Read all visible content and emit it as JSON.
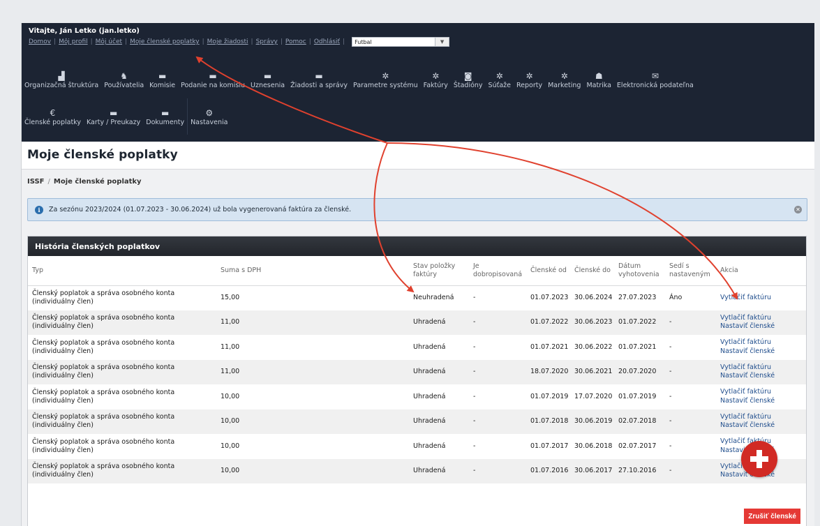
{
  "header": {
    "welcome": "Vitajte, Ján Letko (jan.letko)",
    "links": [
      "Domov",
      "Môj profil",
      "Môj účet",
      "Moje členské poplatky",
      "Moje žiadosti",
      "Správy",
      "Pomoc",
      "Odhlásiť"
    ],
    "sport_select_value": "Futbal"
  },
  "menu": {
    "row1": [
      {
        "label": "Organizačná štruktúra",
        "icon": "org-structure-icon",
        "glyph": "▟"
      },
      {
        "label": "Používatelia",
        "icon": "users-icon",
        "glyph": "♞"
      },
      {
        "label": "Komisie",
        "icon": "folder-icon",
        "glyph": "▬"
      },
      {
        "label": "Podanie na komisiu",
        "icon": "folder-icon",
        "glyph": "▬"
      },
      {
        "label": "Uznesenia",
        "icon": "folder-icon",
        "glyph": "▬"
      },
      {
        "label": "Žiadosti a správy",
        "icon": "folder-icon",
        "glyph": "▬"
      },
      {
        "label": "Parametre systému",
        "icon": "gears-icon",
        "glyph": "✲"
      },
      {
        "label": "Faktúry",
        "icon": "gears-icon",
        "glyph": "✲"
      },
      {
        "label": "Štadióny",
        "icon": "stadium-icon",
        "glyph": "◙"
      },
      {
        "label": "Súťaže",
        "icon": "gears-icon",
        "glyph": "✲"
      },
      {
        "label": "Reporty",
        "icon": "gears-icon",
        "glyph": "✲"
      },
      {
        "label": "Marketing",
        "icon": "gears-icon",
        "glyph": "✲"
      },
      {
        "label": "Matrika",
        "icon": "registry-icon",
        "glyph": "☗"
      },
      {
        "label": "Elektronická podateľna",
        "icon": "envelope-icon",
        "glyph": "✉"
      }
    ],
    "row2": [
      {
        "label": "Členské poplatky",
        "icon": "fees-icon",
        "glyph": "€"
      },
      {
        "label": "Karty / Preukazy",
        "icon": "folder-icon",
        "glyph": "▬"
      },
      {
        "label": "Dokumenty",
        "icon": "folder-icon",
        "glyph": "▬"
      },
      {
        "label": "Nastavenia",
        "icon": "settings-icon",
        "glyph": "⚙"
      }
    ]
  },
  "page": {
    "title": "Moje členské poplatky",
    "breadcrumb_root": "ISSF",
    "breadcrumb_current": "Moje členské poplatky",
    "alert": "Za sezónu 2023/2024 (01.07.2023 - 30.06.2024) už bola vygenerovaná faktúra za členské."
  },
  "history": {
    "title": "História členských poplatkov",
    "columns": {
      "typ": "Typ",
      "suma": "Suma s DPH",
      "stav": "Stav položky faktúry",
      "dobropis": "Je dobropisovaná",
      "od": "Členské od",
      "do": "Členské do",
      "datum": "Dátum vyhotovenia",
      "sedi": "Sedí s nastaveným",
      "akcia": "Akcia"
    },
    "rows": [
      {
        "typ": "Členský poplatok a správa osobného konta (individuálny člen)",
        "suma": "15,00",
        "stav": "Neuhradená",
        "dobropis": "-",
        "od": "01.07.2023",
        "do": "30.06.2024",
        "datum": "27.07.2023",
        "sedi": "Áno",
        "a1": "Vytlačiť faktúru",
        "a2": ""
      },
      {
        "typ": "Členský poplatok a správa osobného konta (individuálny člen)",
        "suma": "11,00",
        "stav": "Uhradená",
        "dobropis": "-",
        "od": "01.07.2022",
        "do": "30.06.2023",
        "datum": "01.07.2022",
        "sedi": "-",
        "a1": "Vytlačiť faktúru",
        "a2": "Nastaviť členské"
      },
      {
        "typ": "Členský poplatok a správa osobného konta (individuálny člen)",
        "suma": "11,00",
        "stav": "Uhradená",
        "dobropis": "-",
        "od": "01.07.2021",
        "do": "30.06.2022",
        "datum": "01.07.2021",
        "sedi": "-",
        "a1": "Vytlačiť faktúru",
        "a2": "Nastaviť členské"
      },
      {
        "typ": "Členský poplatok a správa osobného konta (individuálny člen)",
        "suma": "11,00",
        "stav": "Uhradená",
        "dobropis": "-",
        "od": "18.07.2020",
        "do": "30.06.2021",
        "datum": "20.07.2020",
        "sedi": "-",
        "a1": "Vytlačiť faktúru",
        "a2": "Nastaviť členské"
      },
      {
        "typ": "Členský poplatok a správa osobného konta (individuálny člen)",
        "suma": "10,00",
        "stav": "Uhradená",
        "dobropis": "-",
        "od": "01.07.2019",
        "do": "17.07.2020",
        "datum": "01.07.2019",
        "sedi": "-",
        "a1": "Vytlačiť faktúru",
        "a2": "Nastaviť členské"
      },
      {
        "typ": "Členský poplatok a správa osobného konta (individuálny člen)",
        "suma": "10,00",
        "stav": "Uhradená",
        "dobropis": "-",
        "od": "01.07.2018",
        "do": "30.06.2019",
        "datum": "02.07.2018",
        "sedi": "-",
        "a1": "Vytlačiť faktúru",
        "a2": "Nastaviť členské"
      },
      {
        "typ": "Členský poplatok a správa osobného konta (individuálny člen)",
        "suma": "10,00",
        "stav": "Uhradená",
        "dobropis": "-",
        "od": "01.07.2017",
        "do": "30.06.2018",
        "datum": "02.07.2017",
        "sedi": "-",
        "a1": "Vytlačiť faktúru",
        "a2": "Nastaviť členské"
      },
      {
        "typ": "Členský poplatok a správa osobného konta (individuálny člen)",
        "suma": "10,00",
        "stav": "Uhradená",
        "dobropis": "-",
        "od": "01.07.2016",
        "do": "30.06.2017",
        "datum": "27.10.2016",
        "sedi": "-",
        "a1": "Vytlačiť faktúru",
        "a2": "Nastaviť členské"
      }
    ],
    "cancel_button": "Zrušiť členské"
  },
  "colors": {
    "topbar": "#1c2433",
    "accent_red": "#e53935",
    "annotation_arrow": "#e0412e",
    "link": "#1f4d8c"
  }
}
